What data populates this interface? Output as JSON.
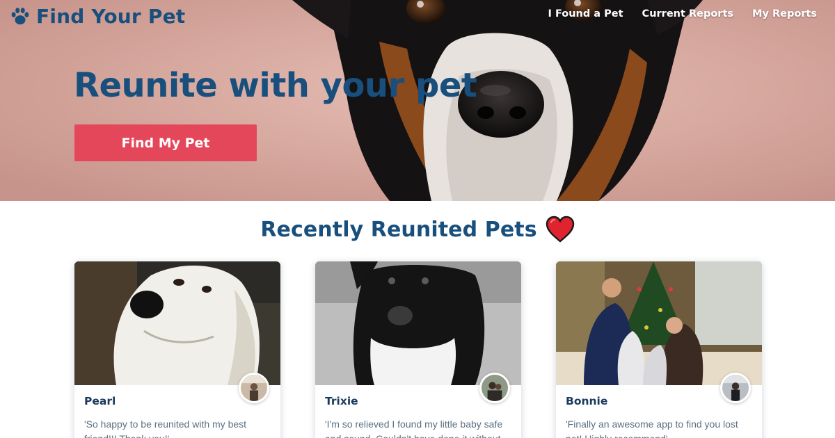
{
  "brand": {
    "title": "Find Your Pet",
    "icon": "paw-icon"
  },
  "nav": {
    "items": [
      {
        "label": "I Found a Pet"
      },
      {
        "label": "Current Reports"
      },
      {
        "label": "My Reports"
      }
    ]
  },
  "hero": {
    "title": "Reunite with your pet",
    "cta_label": "Find My Pet"
  },
  "section": {
    "title": "Recently Reunited Pets",
    "icon": "heart-icon"
  },
  "cards": [
    {
      "name": "Pearl",
      "quote": "'So happy to be reunited with my best friend!!! Thank you!'"
    },
    {
      "name": "Trixie",
      "quote": "'I'm so relieved I found my little baby safe and sound. Couldn't have done it without"
    },
    {
      "name": "Bonnie",
      "quote": "'Finally an awesome app to find you lost pet! Highly recommend'"
    }
  ],
  "colors": {
    "brand": "#184f7d",
    "accent": "#e5475a",
    "heart": "#e0242f",
    "hero_bg": "#d9aca4",
    "body_text": "#5a7184"
  }
}
